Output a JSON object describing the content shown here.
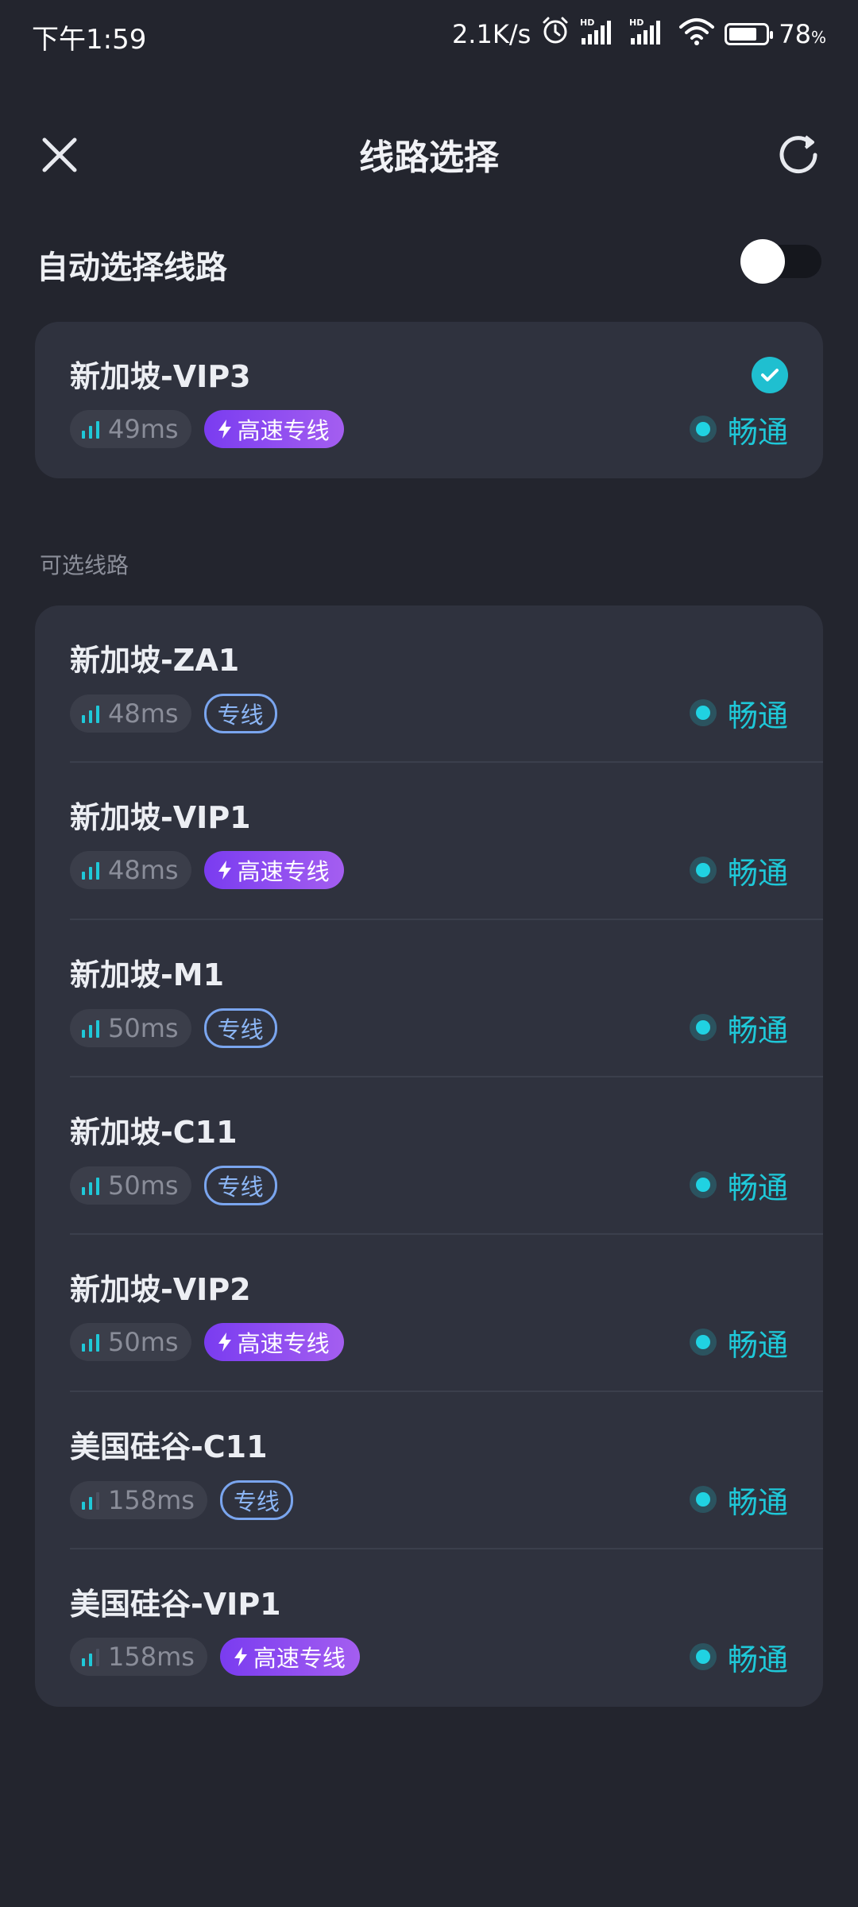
{
  "status_bar": {
    "time": "下午1:59",
    "net_speed": "2.1K/s",
    "battery": "78",
    "battery_unit": "%",
    "battery_level": 0.78
  },
  "header": {
    "title": "线路选择",
    "close_icon": "close-icon",
    "refresh_icon": "refresh-icon"
  },
  "auto_select": {
    "label": "自动选择线路",
    "enabled": false
  },
  "current_line": {
    "name": "新加坡-VIP3",
    "latency": "49ms",
    "tag": "高速专线",
    "tag_type": "vip",
    "status": "畅通",
    "selected": true
  },
  "section_label": "可选线路",
  "lines": [
    {
      "name": "新加坡-ZA1",
      "latency": "48ms",
      "tag": "专线",
      "tag_type": "normal",
      "status": "畅通"
    },
    {
      "name": "新加坡-VIP1",
      "latency": "48ms",
      "tag": "高速专线",
      "tag_type": "vip",
      "status": "畅通"
    },
    {
      "name": "新加坡-M1",
      "latency": "50ms",
      "tag": "专线",
      "tag_type": "normal",
      "status": "畅通"
    },
    {
      "name": "新加坡-C11",
      "latency": "50ms",
      "tag": "专线",
      "tag_type": "normal",
      "status": "畅通"
    },
    {
      "name": "新加坡-VIP2",
      "latency": "50ms",
      "tag": "高速专线",
      "tag_type": "vip",
      "status": "畅通"
    },
    {
      "name": "美国硅谷-C11",
      "latency": "158ms",
      "tag": "专线",
      "tag_type": "normal",
      "status": "畅通"
    },
    {
      "name": "美国硅谷-VIP1",
      "latency": "158ms",
      "tag": "高速专线",
      "tag_type": "vip",
      "status": "畅通"
    }
  ],
  "colors": {
    "background": "#23252e",
    "card": "#2f323e",
    "accent": "#1fc8d8",
    "vip_tag": "#8b4cf0",
    "normal_tag": "#7aa5ee"
  }
}
